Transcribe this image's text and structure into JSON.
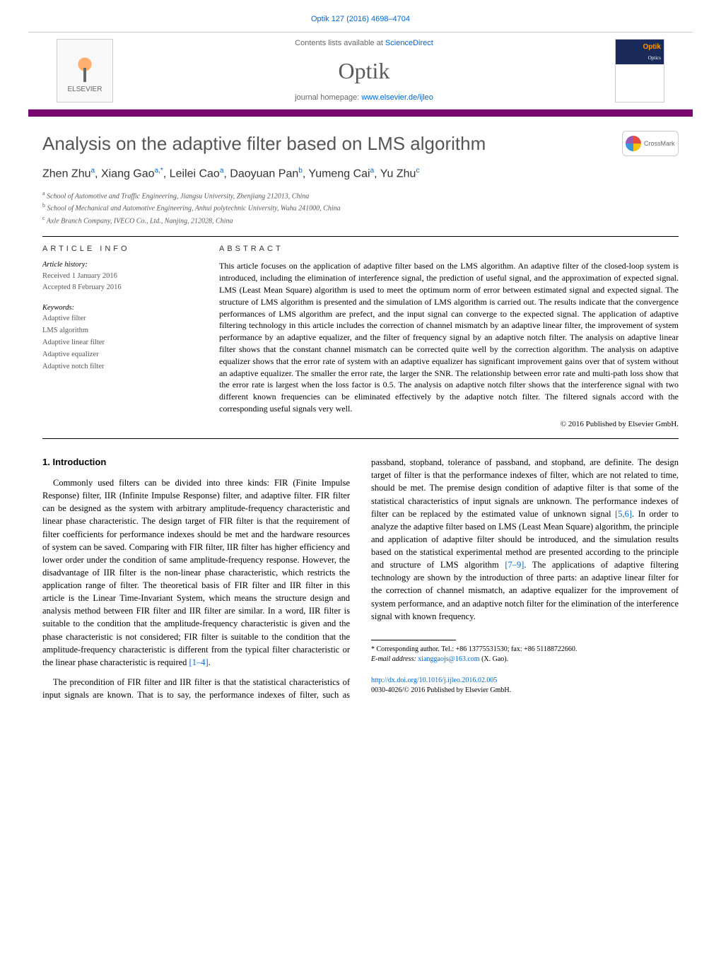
{
  "top_citation": "Optik 127 (2016) 4698–4704",
  "header": {
    "contents_pre": "Contents lists available at ",
    "contents_link": "ScienceDirect",
    "journal": "Optik",
    "homepage_pre": "journal homepage: ",
    "homepage_link": "www.elsevier.de/ijleo",
    "elsevier": "ELSEVIER",
    "cover_title": "Optik",
    "cover_sub": "Optics"
  },
  "crossmark": "CrossMark",
  "title": "Analysis on the adaptive filter based on LMS algorithm",
  "authors_html": "Zhen Zhu<sup>a</sup>, Xiang Gao<sup>a,*</sup>, Leilei Cao<sup>a</sup>, Daoyuan Pan<sup>b</sup>, Yumeng Cai<sup>a</sup>, Yu Zhu<sup>c</sup>",
  "affiliations": [
    {
      "sup": "a",
      "text": "School of Automotive and Traffic Engineering, Jiangsu University, Zhenjiang 212013, China"
    },
    {
      "sup": "b",
      "text": "School of Mechanical and Automotive Engineering, Anhui polytechnic University, Wuhu 241000, China"
    },
    {
      "sup": "c",
      "text": "Axle Branch Company, IVECO Co., Ltd., Nanjing, 212028, China"
    }
  ],
  "article_info_label": "article info",
  "abstract_label": "abstract",
  "history": {
    "title": "Article history:",
    "received": "Received 1 January 2016",
    "accepted": "Accepted 8 February 2016"
  },
  "keywords": {
    "title": "Keywords:",
    "items": [
      "Adaptive filter",
      "LMS algorithm",
      "Adaptive linear filter",
      "Adaptive equalizer",
      "Adaptive notch filter"
    ]
  },
  "abstract_text": "This article focuses on the application of adaptive filter based on the LMS algorithm. An adaptive filter of the closed-loop system is introduced, including the elimination of interference signal, the prediction of useful signal, and the approximation of expected signal. LMS (Least Mean Square) algorithm is used to meet the optimum norm of error between estimated signal and expected signal. The structure of LMS algorithm is presented and the simulation of LMS algorithm is carried out. The results indicate that the convergence performances of LMS algorithm are prefect, and the input signal can converge to the expected signal. The application of adaptive filtering technology in this article includes the correction of channel mismatch by an adaptive linear filter, the improvement of system performance by an adaptive equalizer, and the filter of frequency signal by an adaptive notch filter. The analysis on adaptive linear filter shows that the constant channel mismatch can be corrected quite well by the correction algorithm. The analysis on adaptive equalizer shows that the error rate of system with an adaptive equalizer has significant improvement gains over that of system without an adaptive equalizer. The smaller the error rate, the larger the SNR. The relationship between error rate and multi-path loss show that the error rate is largest when the loss factor is 0.5. The analysis on adaptive notch filter shows that the interference signal with two different known frequencies can be eliminated effectively by the adaptive notch filter. The filtered signals accord with the corresponding useful signals very well.",
  "abstract_copyright": "© 2016 Published by Elsevier GmbH.",
  "intro": {
    "heading": "1. Introduction",
    "p1": "Commonly used filters can be divided into three kinds: FIR (Finite Impulse Response) filter, IIR (Infinite Impulse Response) filter, and adaptive filter. FIR filter can be designed as the system with arbitrary amplitude-frequency characteristic and linear phase characteristic. The design target of FIR filter is that the requirement of filter coefficients for performance indexes should be met and the hardware resources of system can be saved. Comparing with FIR filter, IIR filter has higher efficiency and lower order under the condition of same amplitude-frequency response. However, the disadvantage of IIR filter is the non-linear phase characteristic, which restricts the application range of filter. The theoretical basis of FIR filter and IIR filter in this article is the Linear Time-Invariant System, which means the structure design and analysis method between FIR filter and IIR filter are similar. In a word, IIR filter is suitable to the condition that the amplitude-frequency characteristic is given and the phase characteristic is not considered; FIR filter is suitable to the condition that the amplitude-frequency characteristic is different from the typical filter characteristic or the linear phase characteristic is required ",
    "p1_ref": "[1–4]",
    "p1_tail": ".",
    "p2a": "The precondition of FIR filter and IIR filter is that the statistical characteristics of input signals are known. That is to say, the performance indexes of filter, such as passband, stopband, tolerance of passband, and stopband, are definite. The design target of filter is that the performance indexes of filter, which are not related to time, should be met. The premise design condition of adaptive filter is that some of the statistical characteristics of input signals are unknown. The performance indexes of filter can be replaced by the estimated value of unknown signal ",
    "p2_ref1": "[5,6]",
    "p2b": ". In order to analyze the adaptive filter based on LMS (Least Mean Square) algorithm, the principle and application of adaptive filter should be introduced, and the simulation results based on the statistical experimental method are presented according to the principle and structure of LMS algorithm ",
    "p2_ref2": "[7–9]",
    "p2c": ". The applications of adaptive filtering technology are shown by the introduction of three parts: an adaptive linear filter for the correction of channel mismatch, an adaptive equalizer for the improvement of system performance, and an adaptive notch filter for the elimination of the interference signal with known frequency."
  },
  "footnotes": {
    "corr": "* Corresponding author. Tel.: +86 13775531530; fax: +86 51188722660.",
    "email_label": "E-mail address: ",
    "email": "xianggaojs@163.com",
    "email_tail": " (X. Gao)."
  },
  "doi": {
    "link": "http://dx.doi.org/10.1016/j.ijleo.2016.02.005",
    "line2": "0030-4026/© 2016 Published by Elsevier GmbH."
  }
}
